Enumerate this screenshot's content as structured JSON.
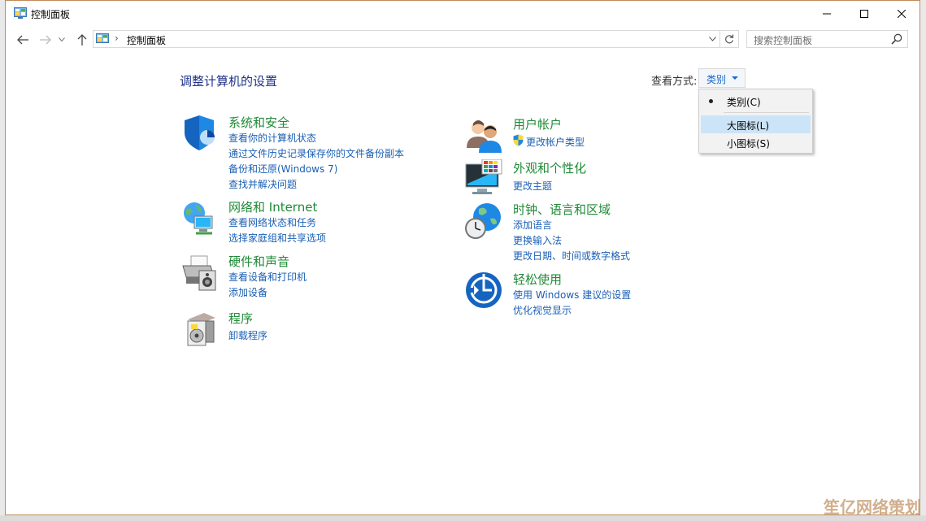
{
  "window": {
    "title": "控制面板"
  },
  "address": {
    "separator": "›",
    "path": "控制面板"
  },
  "search": {
    "placeholder": "搜索控制面板"
  },
  "main": {
    "title": "调整计算机的设置",
    "view_by_label": "查看方式:",
    "view_by_value": "类别"
  },
  "dropdown": {
    "options": [
      {
        "label": "类别(C)",
        "checked": true
      },
      {
        "label": "大图标(L)",
        "highlighted": true
      },
      {
        "label": "小图标(S)"
      }
    ]
  },
  "categories": {
    "system_security": {
      "title": "系统和安全",
      "links": [
        "查看你的计算机状态",
        "通过文件历史记录保存你的文件备份副本",
        "备份和还原(Windows 7)",
        "查找并解决问题"
      ]
    },
    "network": {
      "title": "网络和 Internet",
      "links": [
        "查看网络状态和任务",
        "选择家庭组和共享选项"
      ]
    },
    "hardware": {
      "title": "硬件和声音",
      "links": [
        "查看设备和打印机",
        "添加设备"
      ]
    },
    "programs": {
      "title": "程序",
      "links": [
        "卸载程序"
      ]
    },
    "user_accounts": {
      "title": "用户帐户",
      "links": [
        "更改帐户类型"
      ]
    },
    "appearance": {
      "title": "外观和个性化",
      "links": [
        "更改主题"
      ]
    },
    "clock_region": {
      "title": "时钟、语言和区域",
      "links": [
        "添加语言",
        "更换输入法",
        "更改日期、时间或数字格式"
      ]
    },
    "ease_of_access": {
      "title": "轻松使用",
      "links": [
        "使用 Windows 建议的设置",
        "优化视觉显示"
      ]
    }
  },
  "watermark": "笙亿网络策划",
  "colors": {
    "category_title": "#1f8a37",
    "link": "#1a5fb4",
    "page_title": "#1e3287",
    "dropdown_highlight": "#cce4f7"
  }
}
